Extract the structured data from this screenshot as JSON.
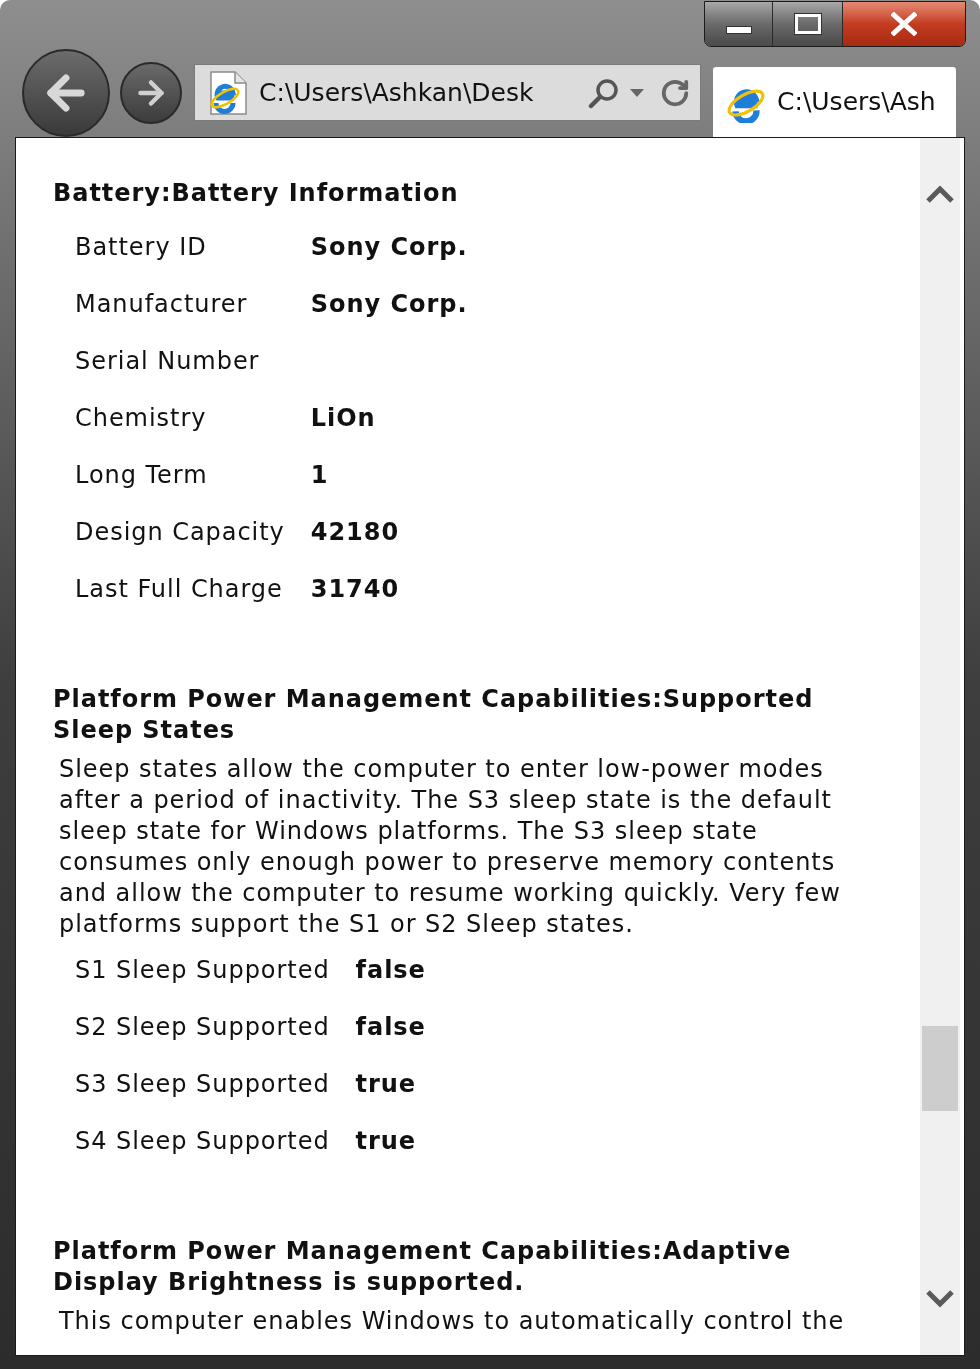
{
  "address_bar": {
    "value": "C:\\Users\\Ashkan\\Desk"
  },
  "tabs": [
    {
      "label": "C:\\Users\\Ash",
      "selected": true
    }
  ],
  "sections": [
    {
      "heading": "Battery:Battery Information",
      "rows": [
        {
          "label": "Battery ID",
          "value": "Sony Corp."
        },
        {
          "label": "Manufacturer",
          "value": "Sony Corp."
        },
        {
          "label": "Serial Number"
        },
        {
          "label": "Chemistry",
          "value": "LiOn"
        },
        {
          "label": "Long Term",
          "value": "1"
        },
        {
          "label": "Design Capacity",
          "value": "42180"
        },
        {
          "label": "Last Full Charge",
          "value": "31740"
        }
      ]
    },
    {
      "heading": "Platform Power Management Capabilities:Supported Sleep States",
      "description": "Sleep states allow the computer to enter low-power modes after a period of inactivity. The S3 sleep state is the default sleep state for Windows platforms. The S3 sleep state consumes only enough power to preserve memory contents and allow the computer to resume working quickly. Very few platforms support the S1 or S2 Sleep states.",
      "rows": [
        {
          "label": "S1 Sleep Supported",
          "value": "false"
        },
        {
          "label": "S2 Sleep Supported",
          "value": "false"
        },
        {
          "label": "S3 Sleep Supported",
          "value": "true"
        },
        {
          "label": "S4 Sleep Supported",
          "value": "true"
        }
      ]
    },
    {
      "heading": "Platform Power Management Capabilities:Adaptive Display Brightness is supported.",
      "description": "This computer enables Windows to automatically control the"
    }
  ]
}
